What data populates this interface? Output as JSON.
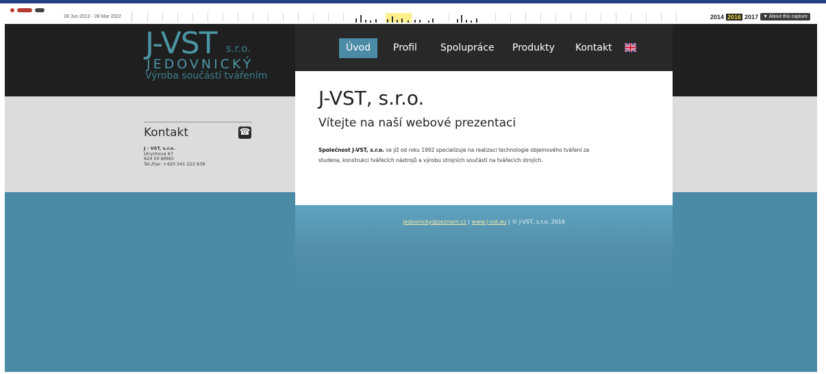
{
  "wayback": {
    "date_range": "28 Jun 2013 - 28 Mar 2022",
    "years": [
      "2014",
      "2016",
      "2017"
    ],
    "current_year": "2016",
    "about_label": "▼ About this capture"
  },
  "logo": {
    "main": "J-VST",
    "sro": "s.r.o.",
    "sub": "JEDOVNICKÝ",
    "tagline": "Výroba součástí tvářením"
  },
  "kontakt": {
    "title": "Kontakt",
    "phone_icon": "☎",
    "lines": [
      "J - VST, s.r.o.",
      "Ulrychova 67",
      "624 00 BRNO",
      "Tel./Fax: +420 541 222 639"
    ]
  },
  "nav": {
    "items": [
      "Úvod",
      "Profil",
      "Spolupráce",
      "Produkty",
      "Kontakt"
    ],
    "active": "Úvod",
    "flag_icon": "uk-flag-icon"
  },
  "content": {
    "title": "J-VST, s.r.o.",
    "subtitle": "Vítejte na naší webové prezentaci",
    "para_bold": "Společnost J-VST, s.r.o.",
    "para_line1": " se již od roku 1992 specializuje na realizaci technologie objemového tváření za",
    "para_line2": "studena, konstrukci tvářecích nástrojů a výrobu strojních součástí na tvářecích strojích."
  },
  "footer": {
    "email": "jedovnicky@seznam.cz",
    "sep1": " | ",
    "web": "www.j-vst.eu",
    "sep2": " | ",
    "copyright": "© J-VST, s.r.o. 2016"
  },
  "colors": {
    "brand_teal": "#4b96a6",
    "nav_active": "#4c8ba5",
    "dark_band": "#1f1f1f",
    "blue_band": "#4c8ba5",
    "wayback_current": "#f4e04d"
  }
}
